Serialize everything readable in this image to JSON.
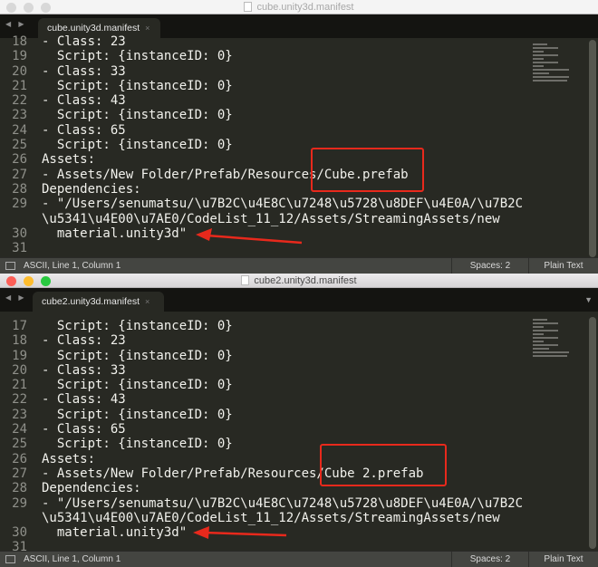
{
  "windows": [
    {
      "title": "cube.unity3d.manifest",
      "tab_label": "cube.unity3d.manifest",
      "tab_close": "×",
      "lines": [
        {
          "num": "18",
          "text": "- Class: 23"
        },
        {
          "num": "19",
          "text": "  Script: {instanceID: 0}"
        },
        {
          "num": "20",
          "text": "- Class: 33"
        },
        {
          "num": "21",
          "text": "  Script: {instanceID: 0}"
        },
        {
          "num": "22",
          "text": "- Class: 43"
        },
        {
          "num": "23",
          "text": "  Script: {instanceID: 0}"
        },
        {
          "num": "24",
          "text": "- Class: 65"
        },
        {
          "num": "25",
          "text": "  Script: {instanceID: 0}"
        },
        {
          "num": "26",
          "text": "Assets:"
        },
        {
          "num": "27",
          "text": "- Assets/New Folder/Prefab/Resources/Cube.prefab"
        },
        {
          "num": "28",
          "text": "Dependencies:"
        },
        {
          "num": "29",
          "text": "- \"/Users/senumatsu/\\u7B2C\\u4E8C\\u7248\\u5728\\u8DEF\\u4E0A/\\u7B2C"
        },
        {
          "num": "",
          "text": "\\u5341\\u4E00\\u7AE0/CodeList_11_12/Assets/StreamingAssets/new"
        },
        {
          "num": "30",
          "text": "  material.unity3d\""
        },
        {
          "num": "31",
          "text": ""
        }
      ],
      "status": {
        "position": "ASCII, Line 1, Column 1",
        "spaces": "Spaces: 2",
        "syntax": "Plain Text"
      }
    },
    {
      "title": "cube2.unity3d.manifest",
      "tab_label": "cube2.unity3d.manifest",
      "tab_close": "×",
      "lines": [
        {
          "num": "17",
          "text": "  Script: {instanceID: 0}"
        },
        {
          "num": "18",
          "text": "- Class: 23"
        },
        {
          "num": "19",
          "text": "  Script: {instanceID: 0}"
        },
        {
          "num": "20",
          "text": "- Class: 33"
        },
        {
          "num": "21",
          "text": "  Script: {instanceID: 0}"
        },
        {
          "num": "22",
          "text": "- Class: 43"
        },
        {
          "num": "23",
          "text": "  Script: {instanceID: 0}"
        },
        {
          "num": "24",
          "text": "- Class: 65"
        },
        {
          "num": "25",
          "text": "  Script: {instanceID: 0}"
        },
        {
          "num": "26",
          "text": "Assets:"
        },
        {
          "num": "27",
          "text": "- Assets/New Folder/Prefab/Resources/Cube 2.prefab"
        },
        {
          "num": "28",
          "text": "Dependencies:"
        },
        {
          "num": "29",
          "text": "- \"/Users/senumatsu/\\u7B2C\\u4E8C\\u7248\\u5728\\u8DEF\\u4E0A/\\u7B2C"
        },
        {
          "num": "",
          "text": "\\u5341\\u4E00\\u7AE0/CodeList_11_12/Assets/StreamingAssets/new"
        },
        {
          "num": "30",
          "text": "  material.unity3d\""
        },
        {
          "num": "31",
          "text": ""
        }
      ],
      "status": {
        "position": "ASCII, Line 1, Column 1",
        "spaces": "Spaces: 2",
        "syntax": "Plain Text"
      }
    }
  ],
  "icons": {
    "nav": "◀ ▶",
    "tab_menu": "▼"
  },
  "colors": {
    "annotation_red": "#e8291c",
    "editor_bg": "#282923",
    "traffic_close": "#fc5f57",
    "traffic_min": "#fdbc2e",
    "traffic_max": "#29c940"
  }
}
